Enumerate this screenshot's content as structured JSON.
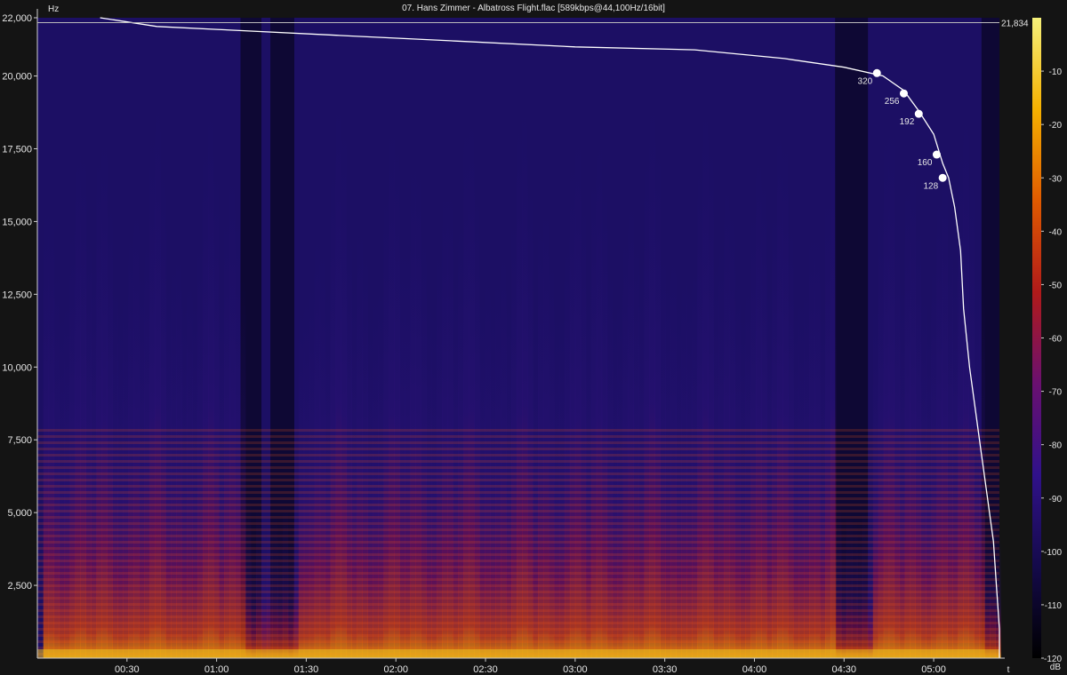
{
  "title": "07. Hans Zimmer - Albatross Flight.flac [589kbps@44,100Hz/16bit]",
  "chart_data": {
    "type": "heatmap",
    "title": "07. Hans Zimmer - Albatross Flight.flac [589kbps@44,100Hz/16bit]",
    "xlabel": "t",
    "ylabel": "Hz",
    "colorbar_label": "dB",
    "ylim": [
      0,
      22000
    ],
    "xlim_seconds": [
      0,
      322
    ],
    "y_ticks": [
      {
        "value": 22000,
        "label": "22,000"
      },
      {
        "value": 20000,
        "label": "20,000"
      },
      {
        "value": 17500,
        "label": "17,500"
      },
      {
        "value": 15000,
        "label": "15,000"
      },
      {
        "value": 12500,
        "label": "12,500"
      },
      {
        "value": 10000,
        "label": "10,000"
      },
      {
        "value": 7500,
        "label": "7,500"
      },
      {
        "value": 5000,
        "label": "5,000"
      },
      {
        "value": 2500,
        "label": "2,500"
      }
    ],
    "x_ticks": [
      {
        "value": 30,
        "label": "00:30"
      },
      {
        "value": 60,
        "label": "01:00"
      },
      {
        "value": 90,
        "label": "01:30"
      },
      {
        "value": 120,
        "label": "02:00"
      },
      {
        "value": 150,
        "label": "02:30"
      },
      {
        "value": 180,
        "label": "03:00"
      },
      {
        "value": 210,
        "label": "03:30"
      },
      {
        "value": 240,
        "label": "04:00"
      },
      {
        "value": 270,
        "label": "04:30"
      },
      {
        "value": 300,
        "label": "05:00"
      }
    ],
    "db_range": [
      -120,
      0
    ],
    "db_ticks": [
      -10,
      -20,
      -30,
      -40,
      -50,
      -60,
      -70,
      -80,
      -90,
      -100,
      -110,
      -120
    ],
    "max_frequency_label": "21,834",
    "max_frequency": 21834,
    "cutoff_curve": [
      [
        21,
        22000
      ],
      [
        40,
        21700
      ],
      [
        60,
        21600
      ],
      [
        100,
        21400
      ],
      [
        140,
        21200
      ],
      [
        180,
        21000
      ],
      [
        220,
        20900
      ],
      [
        250,
        20600
      ],
      [
        270,
        20300
      ],
      [
        283,
        20000
      ],
      [
        290,
        19500
      ],
      [
        295,
        18800
      ],
      [
        300,
        18000
      ],
      [
        303,
        17000
      ],
      [
        305,
        16500
      ],
      [
        306,
        16000
      ],
      [
        307,
        15500
      ],
      [
        309,
        14000
      ],
      [
        310,
        12000
      ],
      [
        312,
        10000
      ],
      [
        314,
        8500
      ],
      [
        316,
        7000
      ],
      [
        318,
        5500
      ],
      [
        320,
        4000
      ],
      [
        321,
        2500
      ],
      [
        322,
        1000
      ],
      [
        322,
        0
      ]
    ],
    "bitrate_markers": [
      {
        "label": "320",
        "t": 281,
        "freq": 20100
      },
      {
        "label": "256",
        "t": 290,
        "freq": 19400
      },
      {
        "label": "192",
        "t": 295,
        "freq": 18700
      },
      {
        "label": "160",
        "t": 301,
        "freq": 17300
      },
      {
        "label": "128",
        "t": 303,
        "freq": 16500
      }
    ],
    "grid": true
  },
  "colors": {
    "background": "#141414",
    "axis": "#cfcfcf",
    "curve": "#ffffff",
    "colormap": [
      "#000000",
      "#140a4a",
      "#30118a",
      "#6a1070",
      "#b01a1a",
      "#e05a00",
      "#f5b000",
      "#f5f07a"
    ]
  }
}
